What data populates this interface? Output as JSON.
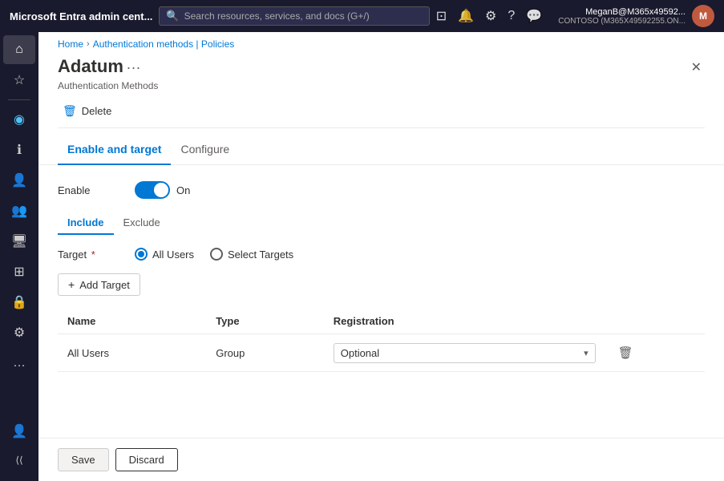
{
  "topbar": {
    "brand": "Microsoft Entra admin cent...",
    "search_placeholder": "Search resources, services, and docs (G+/)",
    "user_name": "MeganB@M365x49592...",
    "user_tenant": "CONTOSO (M365X49592255.ON...",
    "avatar_text": "M"
  },
  "breadcrumb": {
    "home": "Home",
    "section": "Authentication methods | Policies"
  },
  "page": {
    "title": "Adatum",
    "subtitle": "Authentication Methods"
  },
  "toolbar": {
    "delete_label": "Delete"
  },
  "tabs": {
    "enable_target": "Enable and target",
    "configure": "Configure"
  },
  "form": {
    "enable_label": "Enable",
    "toggle_state": "On",
    "include_label": "Include",
    "exclude_label": "Exclude",
    "target_label": "Target",
    "all_users_label": "All Users",
    "select_targets_label": "Select Targets",
    "add_target_label": "Add Target"
  },
  "table": {
    "col_name": "Name",
    "col_type": "Type",
    "col_registration": "Registration",
    "rows": [
      {
        "name": "All Users",
        "type": "Group",
        "registration": "Optional"
      }
    ]
  },
  "footer": {
    "save_label": "Save",
    "discard_label": "Discard"
  },
  "sidebar": {
    "items": [
      {
        "icon": "⌂",
        "label": "home"
      },
      {
        "icon": "☆",
        "label": "favorites"
      },
      {
        "icon": "◉",
        "label": "identity"
      },
      {
        "icon": "ℹ",
        "label": "info"
      },
      {
        "icon": "👤",
        "label": "users"
      },
      {
        "icon": "👥",
        "label": "groups"
      },
      {
        "icon": "🖥",
        "label": "devices"
      },
      {
        "icon": "⊞",
        "label": "apps"
      },
      {
        "icon": "🔒",
        "label": "security"
      },
      {
        "icon": "⚙",
        "label": "settings"
      },
      {
        "icon": "…",
        "label": "more"
      }
    ]
  }
}
